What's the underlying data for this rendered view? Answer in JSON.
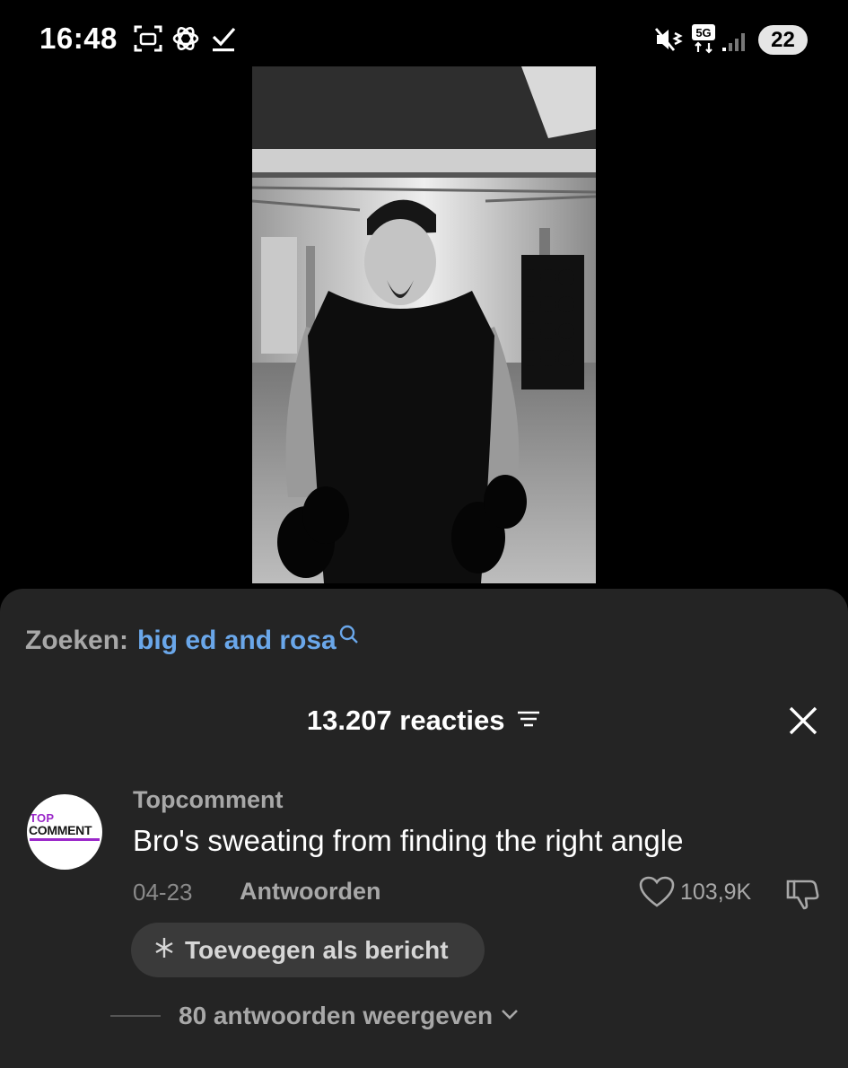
{
  "status_bar": {
    "time": "16:48",
    "network": "5G",
    "battery": "22",
    "left_icons": [
      "screenshot-icon",
      "openai-icon",
      "download-done-icon"
    ],
    "right_icons": [
      "mute-vibrate-icon",
      "network-5g-icon",
      "signal-icon"
    ]
  },
  "video": {
    "description_icon": "gym-video-frame"
  },
  "search": {
    "prefix": "Zoeken:",
    "term": "big ed and rosa"
  },
  "comments": {
    "count_label": "13.207 reacties"
  },
  "comment": {
    "avatar_top": "TOP",
    "avatar_bottom": "COMMENT",
    "username": "Topcomment",
    "text": "Bro's sweating from finding the right angle",
    "date": "04-23",
    "reply_label": "Antwoorden",
    "like_count": "103,9K",
    "add_label": "Toevoegen als bericht",
    "view_replies_label": "80 antwoorden weergeven"
  },
  "colors": {
    "sheet_bg": "#242424",
    "accent_link": "#6aa7ea",
    "pill_bg": "#3a3a3a"
  }
}
